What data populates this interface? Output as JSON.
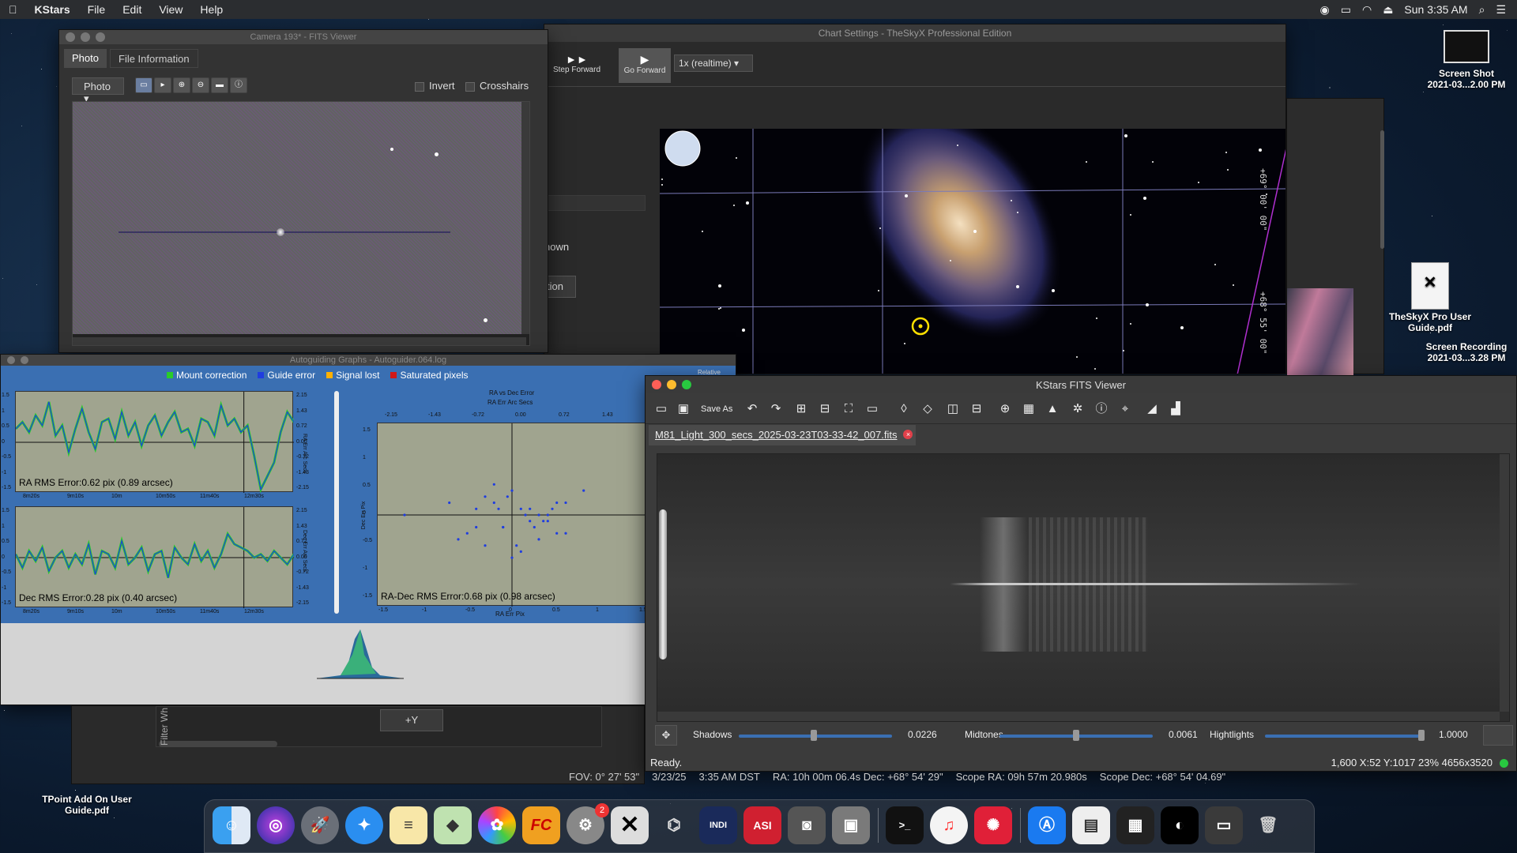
{
  "menubar": {
    "app": "KStars",
    "items": [
      "File",
      "Edit",
      "View",
      "Help"
    ],
    "clock": "Sun 3:35 AM"
  },
  "skyx": {
    "title": "Chart Settings - TheSkyX Professional Edition",
    "step_forward": "Step Forward",
    "go_forward": "Go Forward",
    "speed": "1x (realtime)",
    "side_text_1": "nown",
    "side_text_2": "tion",
    "dec_label_1": "+69° 00' 00\"",
    "dec_label_2": "+68° 55' 00\""
  },
  "camfits": {
    "title": "Camera 193* - FITS Viewer",
    "tabs": [
      "Photo",
      "File Information"
    ],
    "mode": "Photo",
    "invert": "Invert",
    "crosshairs": "Crosshairs"
  },
  "guide": {
    "title": "Autoguiding Graphs - Autoguider.064.log",
    "legend": [
      "Mount correction",
      "Guide error",
      "Signal lost",
      "Saturated pixels"
    ],
    "legend_colors": [
      "#29cc29",
      "#1f3de0",
      "#ffb000",
      "#d01818"
    ],
    "relative": "Relative",
    "ra_label": "RA RMS Error:0.62 pix (0.89 arcsec)",
    "dec_label": "Dec RMS Error:0.28 pix (0.40 arcsec)",
    "radec_label": "RA-Dec RMS Error:0.68 pix (0.98 arcsec)",
    "scatter_title": "RA vs Dec Error",
    "scatter_sub": "RA Err Arc Secs",
    "scatter_xlabel": "RA Err Pix",
    "scatter_ylabel": "Dec Err Pix",
    "time_ticks": [
      "8m20s",
      "9m10s",
      "10m",
      "10m50s",
      "11m40s",
      "12m30s"
    ],
    "right_ticks": [
      "2.15",
      "1.43",
      "0.72",
      "0.00",
      "-0.72",
      "-1.43",
      "-2.15"
    ],
    "left_ticks": [
      "1.5",
      "1",
      "0.5",
      "0",
      "-0.5",
      "-1",
      "-1.5"
    ],
    "ra_axis_label": "RA Err Arc Secs",
    "dec_axis_label": "Dec Err Arc Secs",
    "scatter_top_ticks": [
      "-2.15",
      "-1.43",
      "-0.72",
      "0.00",
      "0.72",
      "1.43",
      "2.15"
    ],
    "scatter_bottom_ticks": [
      "-1.5",
      "-1",
      "-0.5",
      "0",
      "0.5",
      "1",
      "1.5"
    ],
    "y_button": "+Y",
    "filter_text": "Filter Wh"
  },
  "kfits": {
    "title": "KStars FITS Viewer",
    "save_as": "Save As",
    "file_tab": "M81_Light_300_secs_2025-03-23T03-33-42_007.fits",
    "shadows_label": "Shadows",
    "shadows_value": "0.0226",
    "shadows_level": 0.49,
    "midtones_label": "Midtones",
    "midtones_value": "0.0061",
    "midtones_level": 0.5,
    "highlights_label": "Hightlights",
    "highlights_value": "1.0000",
    "highlights_level": 1.0,
    "status": "Ready.",
    "info": "1,600  X:52 Y:1017  23%  4656x3520"
  },
  "statusbar": {
    "fov": "FOV: 0° 27' 53\"",
    "date": "3/23/25",
    "time": "3:35 AM DST",
    "ra": "RA: 10h 00m 06.4s Dec: +68° 54' 29\"",
    "scope_ra": "Scope RA: 09h 57m 20.980s",
    "scope_dec": "Scope Dec: +68° 54' 04.69\""
  },
  "desktop": {
    "icon1": "Screen Shot",
    "icon1b": "2021-03...2.00 PM",
    "icon2": "TheSkyX Pro User Guide.pdf",
    "icon3": "Screen Recording",
    "icon3b": "2021-03...3.28 PM",
    "icon4": "TPoint Add On User Guide.pdf"
  },
  "dock": {
    "badge": "2",
    "asi": "ASI",
    "fc": "FC",
    "indi": "INDI"
  },
  "chart_data": [
    {
      "type": "line",
      "series": [
        {
          "name": "RA error",
          "values": [
            0.4,
            0.6,
            0.3,
            0.8,
            0.5,
            1.2,
            0.2,
            0.5,
            -0.3,
            0.4,
            1.0,
            0.3,
            -0.2,
            0.6,
            0.7,
            0.1,
            0.9,
            0.2,
            0.6,
            -0.1,
            0.5,
            0.8,
            0.2,
            0.6,
            0.9,
            0.3,
            0.4,
            -0.1,
            0.7,
            0.6,
            0.2,
            1.1,
            0.5,
            0.7,
            0.3,
            0.5,
            -0.4,
            -1.4,
            -1.0,
            -0.6,
            0.3,
            0.9,
            0.6
          ]
        }
      ],
      "ylim": [
        -1.5,
        1.5
      ]
    },
    {
      "type": "line",
      "series": [
        {
          "name": "Dec error",
          "values": [
            0.1,
            -0.3,
            0.2,
            -0.1,
            0.3,
            -0.4,
            0.0,
            0.2,
            -0.3,
            0.1,
            -0.2,
            0.4,
            -0.5,
            0.2,
            0.1,
            -0.3,
            0.5,
            -0.2,
            0.0,
            0.3,
            -0.4,
            0.1,
            0.2,
            -0.6,
            0.3,
            0.0,
            -0.2,
            0.4,
            -0.1,
            0.2,
            -0.3,
            0.1,
            0.7,
            0.4,
            0.3,
            0.2,
            0.0,
            0.1,
            -0.1,
            0.2,
            0.0,
            -0.2,
            0.1
          ]
        }
      ],
      "ylim": [
        -1.5,
        1.5
      ]
    },
    {
      "type": "scatter",
      "x": [
        -1.2,
        -0.7,
        -0.5,
        -0.4,
        -0.3,
        -0.2,
        -0.1,
        0,
        0.1,
        0.2,
        0.3,
        0.4,
        0.5,
        0.6,
        -0.6,
        -0.3,
        0.0,
        0.2,
        0.4,
        -0.2,
        0.1,
        0.3,
        -0.1,
        0.6,
        0.8,
        0.5,
        -0.4,
        0.15,
        0.25,
        -0.05,
        0.35,
        0.45,
        0.05,
        -0.15
      ],
      "y": [
        0.0,
        0.2,
        -0.3,
        0.1,
        -0.5,
        0.2,
        -0.2,
        0.4,
        -0.6,
        0.1,
        0.0,
        -0.1,
        -0.3,
        0.2,
        -0.4,
        0.3,
        -0.7,
        -0.1,
        0.0,
        0.5,
        0.1,
        -0.4,
        -0.2,
        -0.3,
        0.4,
        0.2,
        -0.2,
        0.0,
        -0.2,
        0.3,
        -0.1,
        0.1,
        -0.5,
        0.1
      ],
      "xlim": [
        -1.5,
        1.5
      ],
      "ylim": [
        -1.5,
        1.5
      ]
    }
  ]
}
